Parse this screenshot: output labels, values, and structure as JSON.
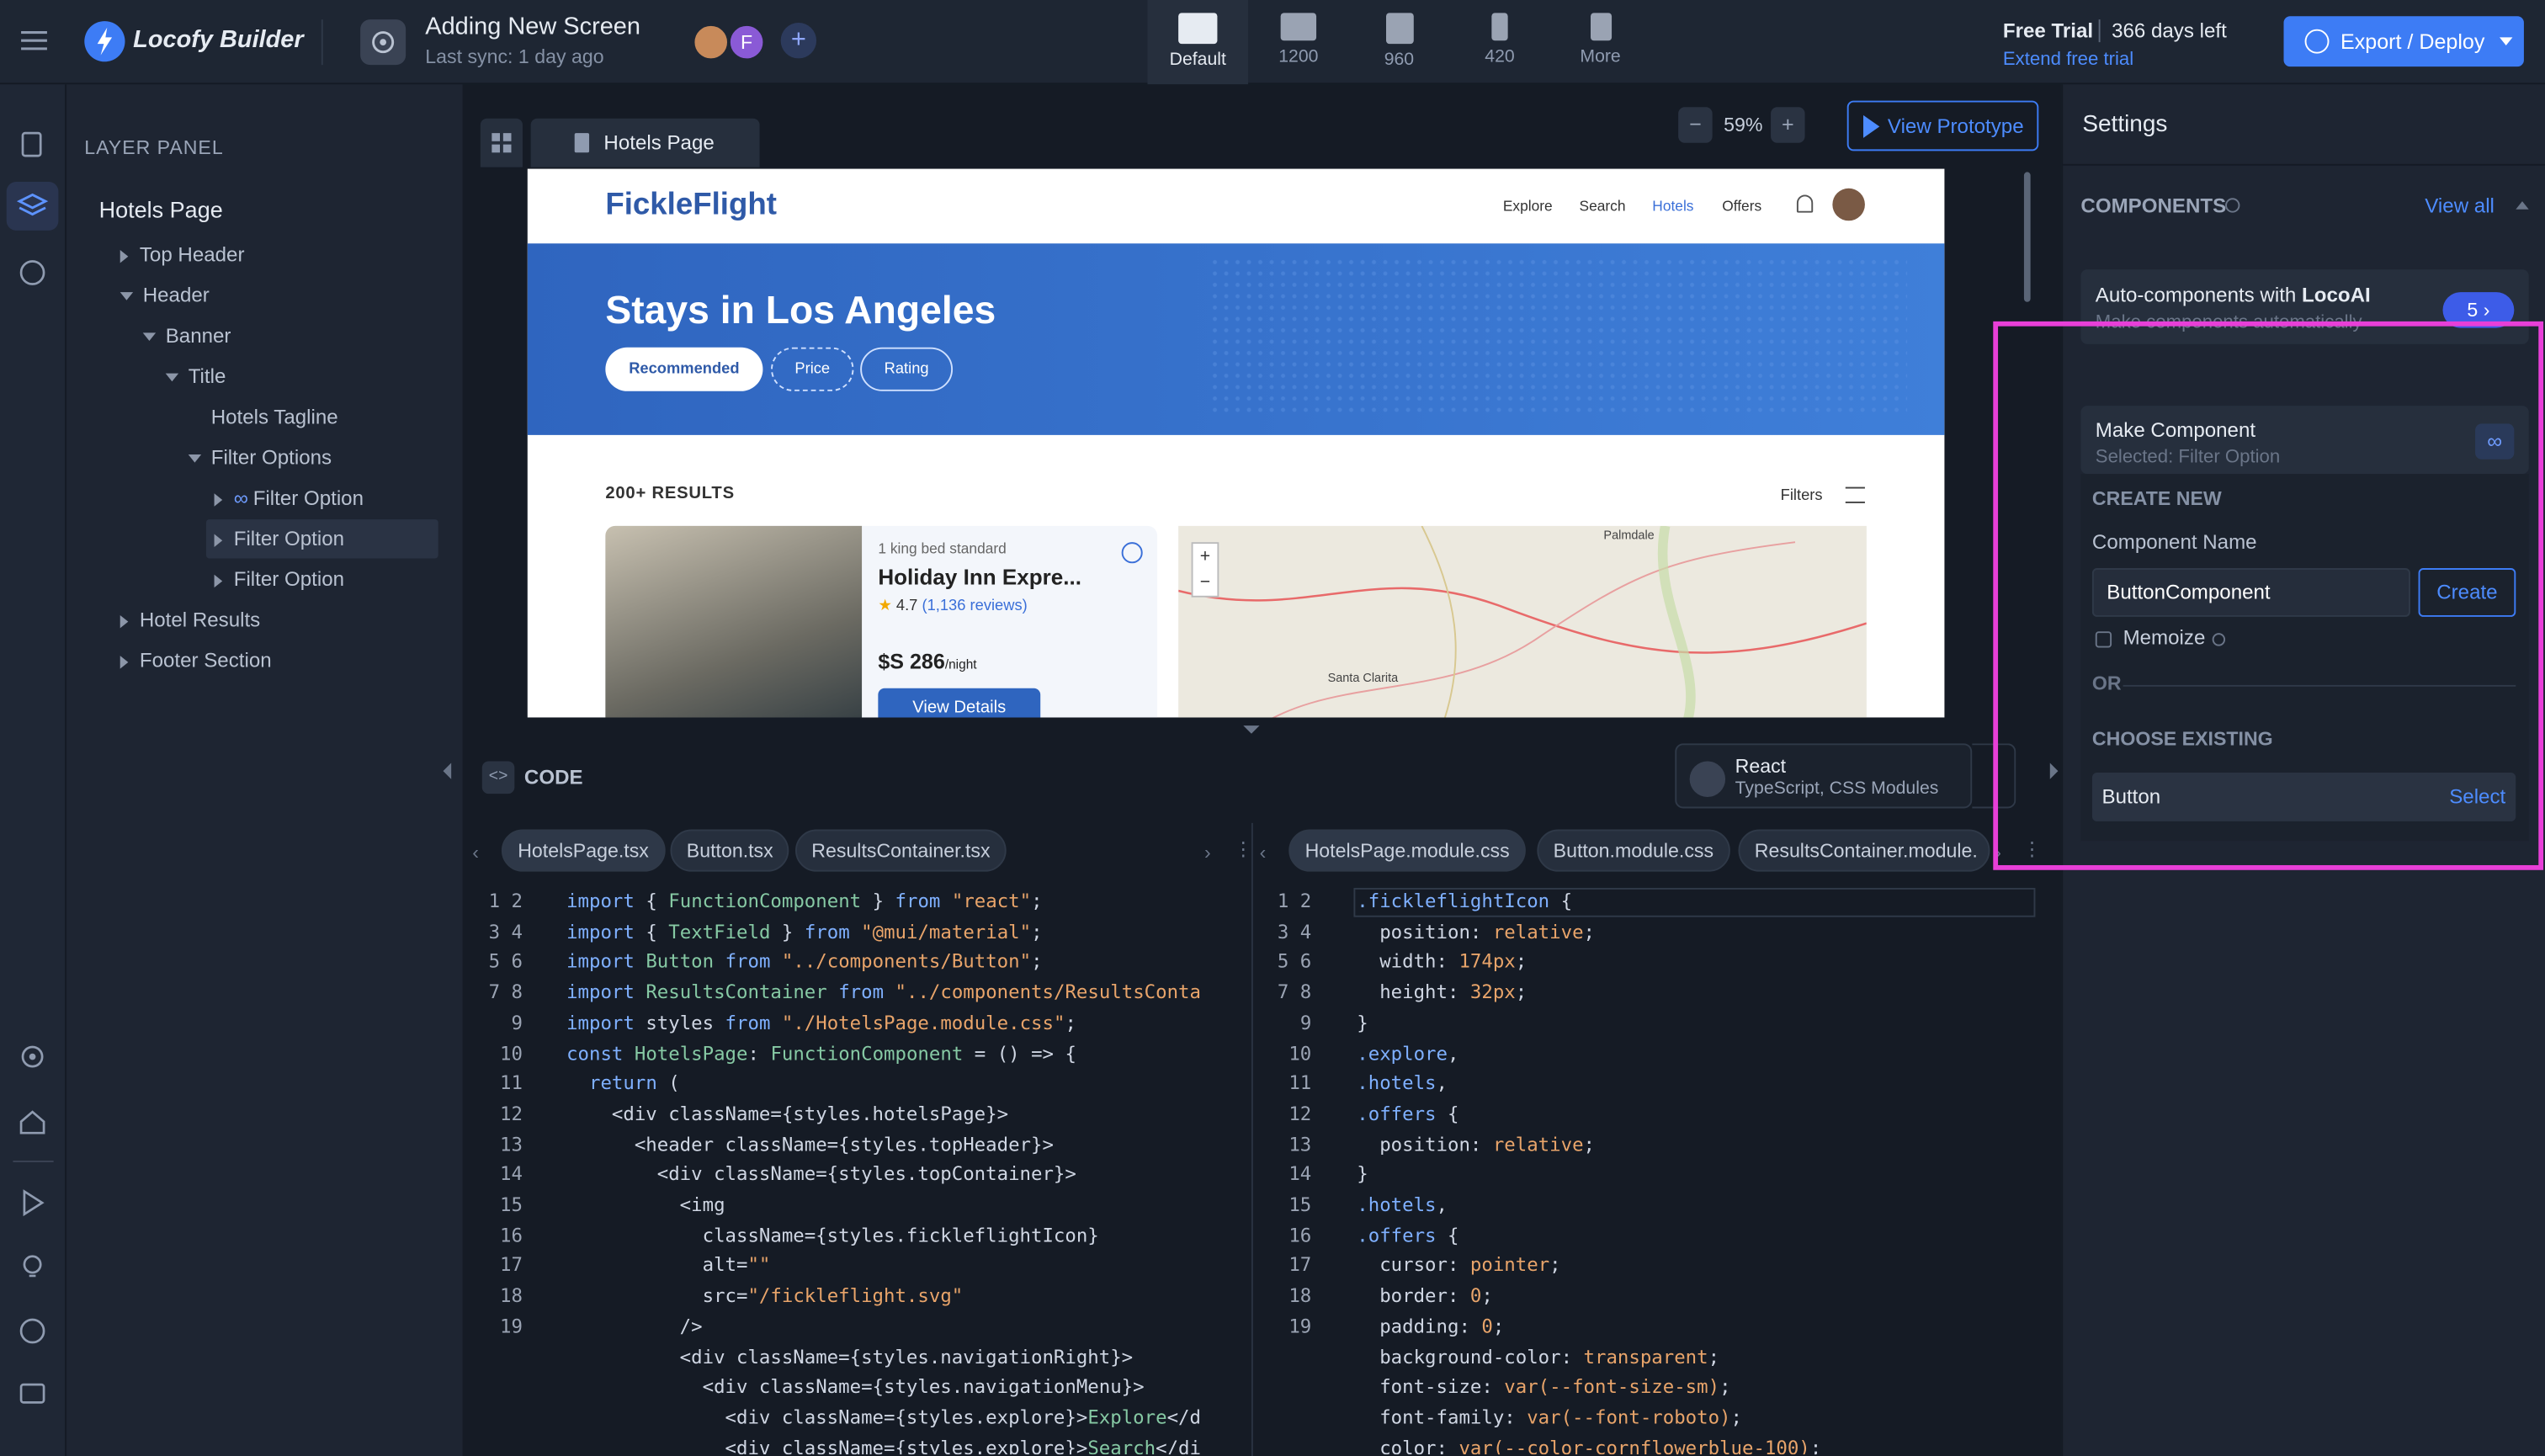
{
  "brand": {
    "name": "Locofy Builder"
  },
  "project": {
    "title": "Adding New Screen",
    "sync": "Last sync: 1 day ago",
    "avatar_letter": "F"
  },
  "devices": [
    {
      "label": "Default"
    },
    {
      "label": "1200"
    },
    {
      "label": "960"
    },
    {
      "label": "420"
    },
    {
      "label": "More"
    }
  ],
  "trial": {
    "label": "Free Trial",
    "days": "366 days left",
    "extend": "Extend free trial"
  },
  "export_label": "Export / Deploy",
  "layer_panel": {
    "heading": "LAYER PANEL",
    "page": "Hotels Page",
    "items": [
      "Top Header",
      "Header",
      "Banner",
      "Title",
      "Hotels Tagline",
      "Filter Options",
      "Filter Option",
      "Filter Option",
      "Filter Option",
      "Hotel Results",
      "Footer Section"
    ]
  },
  "canvas": {
    "tab": "Hotels Page",
    "zoom": "59%",
    "view_prototype": "View Prototype"
  },
  "preview": {
    "logo": "FickleFlight",
    "nav": [
      "Explore",
      "Search",
      "Hotels",
      "Offers"
    ],
    "banner_title": "Stays in Los Angeles",
    "filters": [
      "Recommended",
      "Price",
      "Rating"
    ],
    "results": "200+ RESULTS",
    "filters_label": "Filters",
    "card": {
      "sub": "1 king bed standard",
      "name": "Holiday Inn Expre...",
      "rating": "4.7",
      "reviews": "(1,136 reviews)",
      "price": "$S 286",
      "per": "/night",
      "cta": "View Details"
    },
    "map_labels": [
      "Palmdale",
      "Santa Clarita"
    ]
  },
  "code": {
    "heading": "CODE",
    "framework": "React",
    "framework_sub": "TypeScript, CSS Modules",
    "left_tabs": [
      "HotelsPage.tsx",
      "Button.tsx",
      "ResultsContainer.tsx"
    ],
    "right_tabs": [
      "HotelsPage.module.css",
      "Button.module.css",
      "ResultsContainer.module."
    ]
  },
  "settings": {
    "title": "Settings",
    "components": "COMPONENTS",
    "view_all": "View all",
    "auto_prefix": "Auto-components with ",
    "auto_brand": "LocoAI",
    "auto_sub": "Make components automatically",
    "auto_count": "5",
    "make": "Make Component",
    "selected": "Selected: Filter Option",
    "create_new": "CREATE NEW",
    "comp_name_label": "Component Name",
    "comp_name_value": "ButtonComponent",
    "create_btn": "Create",
    "memoize": "Memoize",
    "or": "OR",
    "choose_existing": "CHOOSE EXISTING",
    "existing_name": "Button",
    "select": "Select"
  },
  "colors": {
    "accent": "#3d7cf5",
    "highlight": "#e83fd8",
    "banner": "#3a70c8"
  }
}
